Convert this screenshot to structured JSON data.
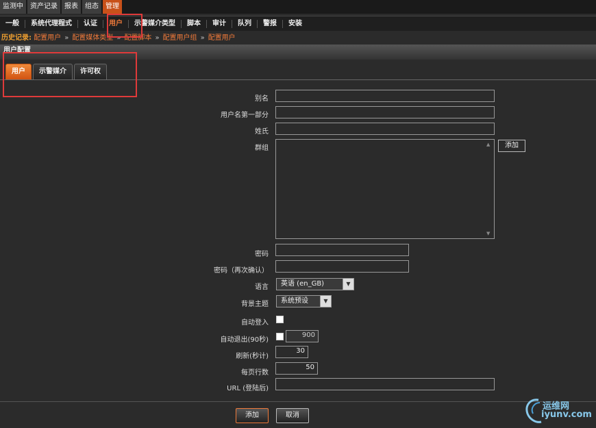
{
  "top_tabs": [
    {
      "label": "监测中",
      "active": false
    },
    {
      "label": "资产记录",
      "active": false
    },
    {
      "label": "报表",
      "active": false
    },
    {
      "label": "组态",
      "active": false
    },
    {
      "label": "管理",
      "active": true
    }
  ],
  "second_nav": [
    {
      "label": "一般",
      "active": false
    },
    {
      "label": "系统代理程式",
      "active": false
    },
    {
      "label": "认证",
      "active": false
    },
    {
      "label": "用户",
      "active": true
    },
    {
      "label": "示警媒介类型",
      "active": false
    },
    {
      "label": "脚本",
      "active": false
    },
    {
      "label": "审计",
      "active": false
    },
    {
      "label": "队列",
      "active": false
    },
    {
      "label": "警报",
      "active": false
    },
    {
      "label": "安装",
      "active": false
    }
  ],
  "history": {
    "label": "历史记录:",
    "items": [
      "配置用户",
      "配置媒体类型",
      "配置脚本",
      "配置用户组",
      "配置用户"
    ],
    "separator": "»"
  },
  "section_title": "用户配置",
  "form_tabs": [
    {
      "label": "用户",
      "active": true
    },
    {
      "label": "示警媒介",
      "active": false
    },
    {
      "label": "许可权",
      "active": false
    }
  ],
  "form": {
    "alias_label": "别名",
    "alias_value": "",
    "name_label": "用户名第一部分",
    "name_value": "",
    "surname_label": "姓氏",
    "surname_value": "",
    "groups_label": "群组",
    "groups_add_label": "添加",
    "password_label": "密码",
    "password_confirm_label": "密码（再次确认）",
    "language_label": "语言",
    "language_value": "英语 (en_GB)",
    "theme_label": "背景主题",
    "theme_value": "系统预设",
    "autologin_label": "自动登入",
    "autologout_label": "自动退出(90秒)",
    "autologout_value": "900",
    "refresh_label": "刷新(秒计)",
    "refresh_value": "30",
    "rows_label": "每页行数",
    "rows_value": "50",
    "url_label": "URL (登陆后)",
    "url_value": ""
  },
  "footer": {
    "add_label": "添加",
    "cancel_label": "取消"
  },
  "watermark": {
    "line1": "运维网",
    "line2": "iyunv.com"
  },
  "colors": {
    "accent": "#f07a3a",
    "highlight_box": "#e03a3a",
    "background": "#2b2b2b"
  }
}
